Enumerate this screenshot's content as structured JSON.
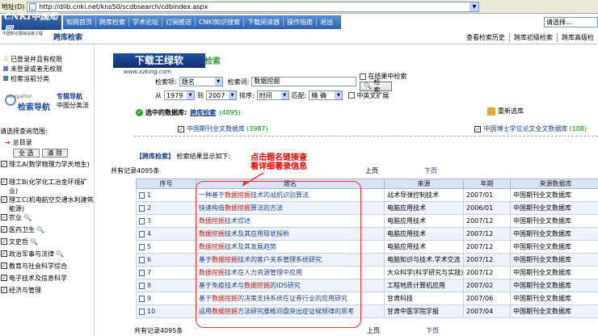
{
  "address": {
    "label": "地址(D)",
    "url": "http://dlib.cnki.net/kns50/scdbsearch/cdbindex.aspx"
  },
  "header": {
    "logo_main": "CNKI中国知网",
    "logo_sub": "中国知识基础设施工程",
    "nav": [
      "知网首页",
      "跨库检索",
      "学术论坛",
      "订阅推送",
      "CNKI知识搜索",
      "下载阅读器",
      "操作指南",
      "退出"
    ],
    "section_title": "跨库检索",
    "search_placeholder": "请选择...",
    "links": [
      "查看检索历史",
      "跨库初级检索",
      "跨库高级检"
    ]
  },
  "left": {
    "options": [
      {
        "icon": "⚠",
        "label": "已登录并且有权限"
      },
      {
        "icon": "■",
        "label": "未登录或者无权限"
      },
      {
        "icon": "■",
        "label": "检索当前分类"
      }
    ],
    "nav_sub": "navigation",
    "nav_main": "检索导航",
    "nav_col_title": "专辑导航",
    "nav_col_text": "中图分类法",
    "scope_label": "请选择查询范围:",
    "root_label": "总目录",
    "btn_all": "全 选",
    "btn_clear": "清 除",
    "categories": [
      "理工A(数学物理力学天地生)",
      "理工B(化学化工冶金环境矿业)",
      "理工C(机电航空交通水利建筑能源)",
      "农业",
      "医药卫生",
      "文史哲",
      "政治军事与法律",
      "教育与社会科学综合",
      "电子技术及信息科学",
      "经济与管理"
    ]
  },
  "main": {
    "banner": "下载王绿软",
    "banner_sub": "检索",
    "banner_url": "www.xzking.com",
    "field_label": "检索项:",
    "field_value": "题名",
    "keyword_label": "检索词:",
    "keyword_value": "数据挖掘",
    "within_label": "在结果中检索",
    "search_btn": "检 索",
    "from_label": "从",
    "year_from": "1979",
    "to_label": "到",
    "year_to": "2007",
    "sort_label": "排序:",
    "sort_value": "时间",
    "match_label": "匹配:",
    "match_value": "精 确",
    "cn_en_label": "中英文扩展",
    "selected_label": "选中的数据库:",
    "selected_link": "跨库检索",
    "selected_count": "(4095)",
    "reset_label": "重新选库",
    "db1_name": "中国期刊全文数据库",
    "db1_count": "(3987)",
    "db2_name": "中国博士学位论文全文数据库",
    "db2_count": "(108)",
    "result_tag": "【跨库检索】",
    "result_text": "检索结果显示如下:",
    "annot_line1": "点击题名链接查",
    "annot_line2": "看详细著录信息",
    "total": "共有记录4095条",
    "prev": "上页",
    "next": "下页"
  },
  "table": {
    "headers": [
      "序号",
      "题名",
      "来源",
      "年期",
      "来源数据库"
    ],
    "rows": [
      {
        "no": "1",
        "pre": "一种基于",
        "hl": "数据挖掘",
        "post": "技术的战机识别算法",
        "src": "战术导弹控制技术",
        "year": "2007/01",
        "db": "中国期刊全文数据库"
      },
      {
        "no": "2",
        "pre": "快速构造",
        "hl": "数据挖掘",
        "post": "算法的方法",
        "src": "电脑应用技术",
        "year": "2006/01",
        "db": "中国期刊全文数据库"
      },
      {
        "no": "3",
        "pre": "",
        "hl": "数据挖掘",
        "post": "技术综述",
        "src": "电脑应用技术",
        "year": "2007/12",
        "db": "中国期刊全文数据库"
      },
      {
        "no": "4",
        "pre": "",
        "hl": "数据挖掘",
        "post": "技术及其应用现状探析",
        "src": "电脑应用技术",
        "year": "2007/12",
        "db": "中国期刊全文数据库"
      },
      {
        "no": "5",
        "pre": "",
        "hl": "数据挖掘",
        "post": "技术及其发展趋势",
        "src": "电脑应用技术",
        "year": "2007/12",
        "db": "中国期刊全文数据库"
      },
      {
        "no": "6",
        "pre": "基于",
        "hl": "数据挖掘",
        "post": "技术的客户关系管理系统研究",
        "src": "电脑知识与技术.学术交流",
        "year": "2007/12",
        "db": "中国期刊全文数据库"
      },
      {
        "no": "7",
        "pre": "",
        "hl": "数据挖掘",
        "post": "技术在人力资源管理中应用",
        "src": "大众科学(科学研究与实践)",
        "year": "2007/12",
        "db": "中国期刊全文数据库"
      },
      {
        "no": "8",
        "pre": "基于免疫技术与",
        "hl": "数据挖掘",
        "post": "的IDS研究",
        "src": "工程地质计算机应用",
        "year": "2007/02",
        "db": "中国期刊全文数据库"
      },
      {
        "no": "9",
        "pre": "基于",
        "hl": "数据挖掘",
        "post": "的决策支持系统在证券行业的应用研究",
        "src": "甘肃科技",
        "year": "2007/06",
        "db": "中国期刊全文数据库"
      },
      {
        "no": "10",
        "pre": "运用",
        "hl": "数据挖掘",
        "post": "方法研究腰椎间盘突出症证候规律的思考",
        "src": "甘肃中医学院学报",
        "year": "2007/04",
        "db": "中国期刊全文数据库"
      }
    ]
  }
}
